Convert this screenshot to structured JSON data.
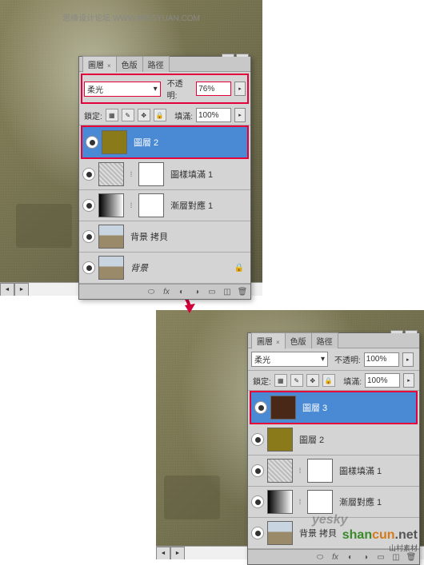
{
  "watermarks": {
    "top_forum": "思缘设计论坛  WWW.MISSYUAN.COM",
    "bottom_brand": "shancun",
    "bottom_url": ".net",
    "bottom_sub": "山村素材",
    "yesky": "yesky"
  },
  "panel_top": {
    "tabs": {
      "layers": "圖層",
      "channels": "色版",
      "paths": "路徑"
    },
    "blend_mode": "柔光",
    "opacity_label": "不透明:",
    "opacity_value": "76%",
    "lock_label": "鎖定:",
    "fill_label": "填滿:",
    "fill_value": "100%",
    "layers": [
      {
        "name": "圖層 2",
        "kind": "olive",
        "selected": true,
        "visible": true
      },
      {
        "name": "圖樣填滿 1",
        "kind": "pattern",
        "selected": false,
        "visible": true
      },
      {
        "name": "漸層對應 1",
        "kind": "gradient",
        "selected": false,
        "visible": true
      },
      {
        "name": "背景 拷貝",
        "kind": "image",
        "selected": false,
        "visible": true
      },
      {
        "name": "背景",
        "kind": "image",
        "selected": false,
        "visible": true,
        "italic": true,
        "locked": true
      }
    ]
  },
  "panel_bottom": {
    "tabs": {
      "layers": "圖層",
      "channels": "色版",
      "paths": "路徑"
    },
    "blend_mode": "柔光",
    "opacity_label": "不透明:",
    "opacity_value": "100%",
    "lock_label": "鎖定:",
    "fill_label": "填滿:",
    "fill_value": "100%",
    "layers": [
      {
        "name": "圖層 3",
        "kind": "brown",
        "selected": true,
        "visible": true
      },
      {
        "name": "圖層 2",
        "kind": "olive",
        "selected": false,
        "visible": true
      },
      {
        "name": "圖樣填滿 1",
        "kind": "pattern",
        "selected": false,
        "visible": true
      },
      {
        "name": "漸層對應 1",
        "kind": "gradient",
        "selected": false,
        "visible": true
      },
      {
        "name": "背景 拷貝",
        "kind": "image",
        "selected": false,
        "visible": true
      }
    ]
  }
}
